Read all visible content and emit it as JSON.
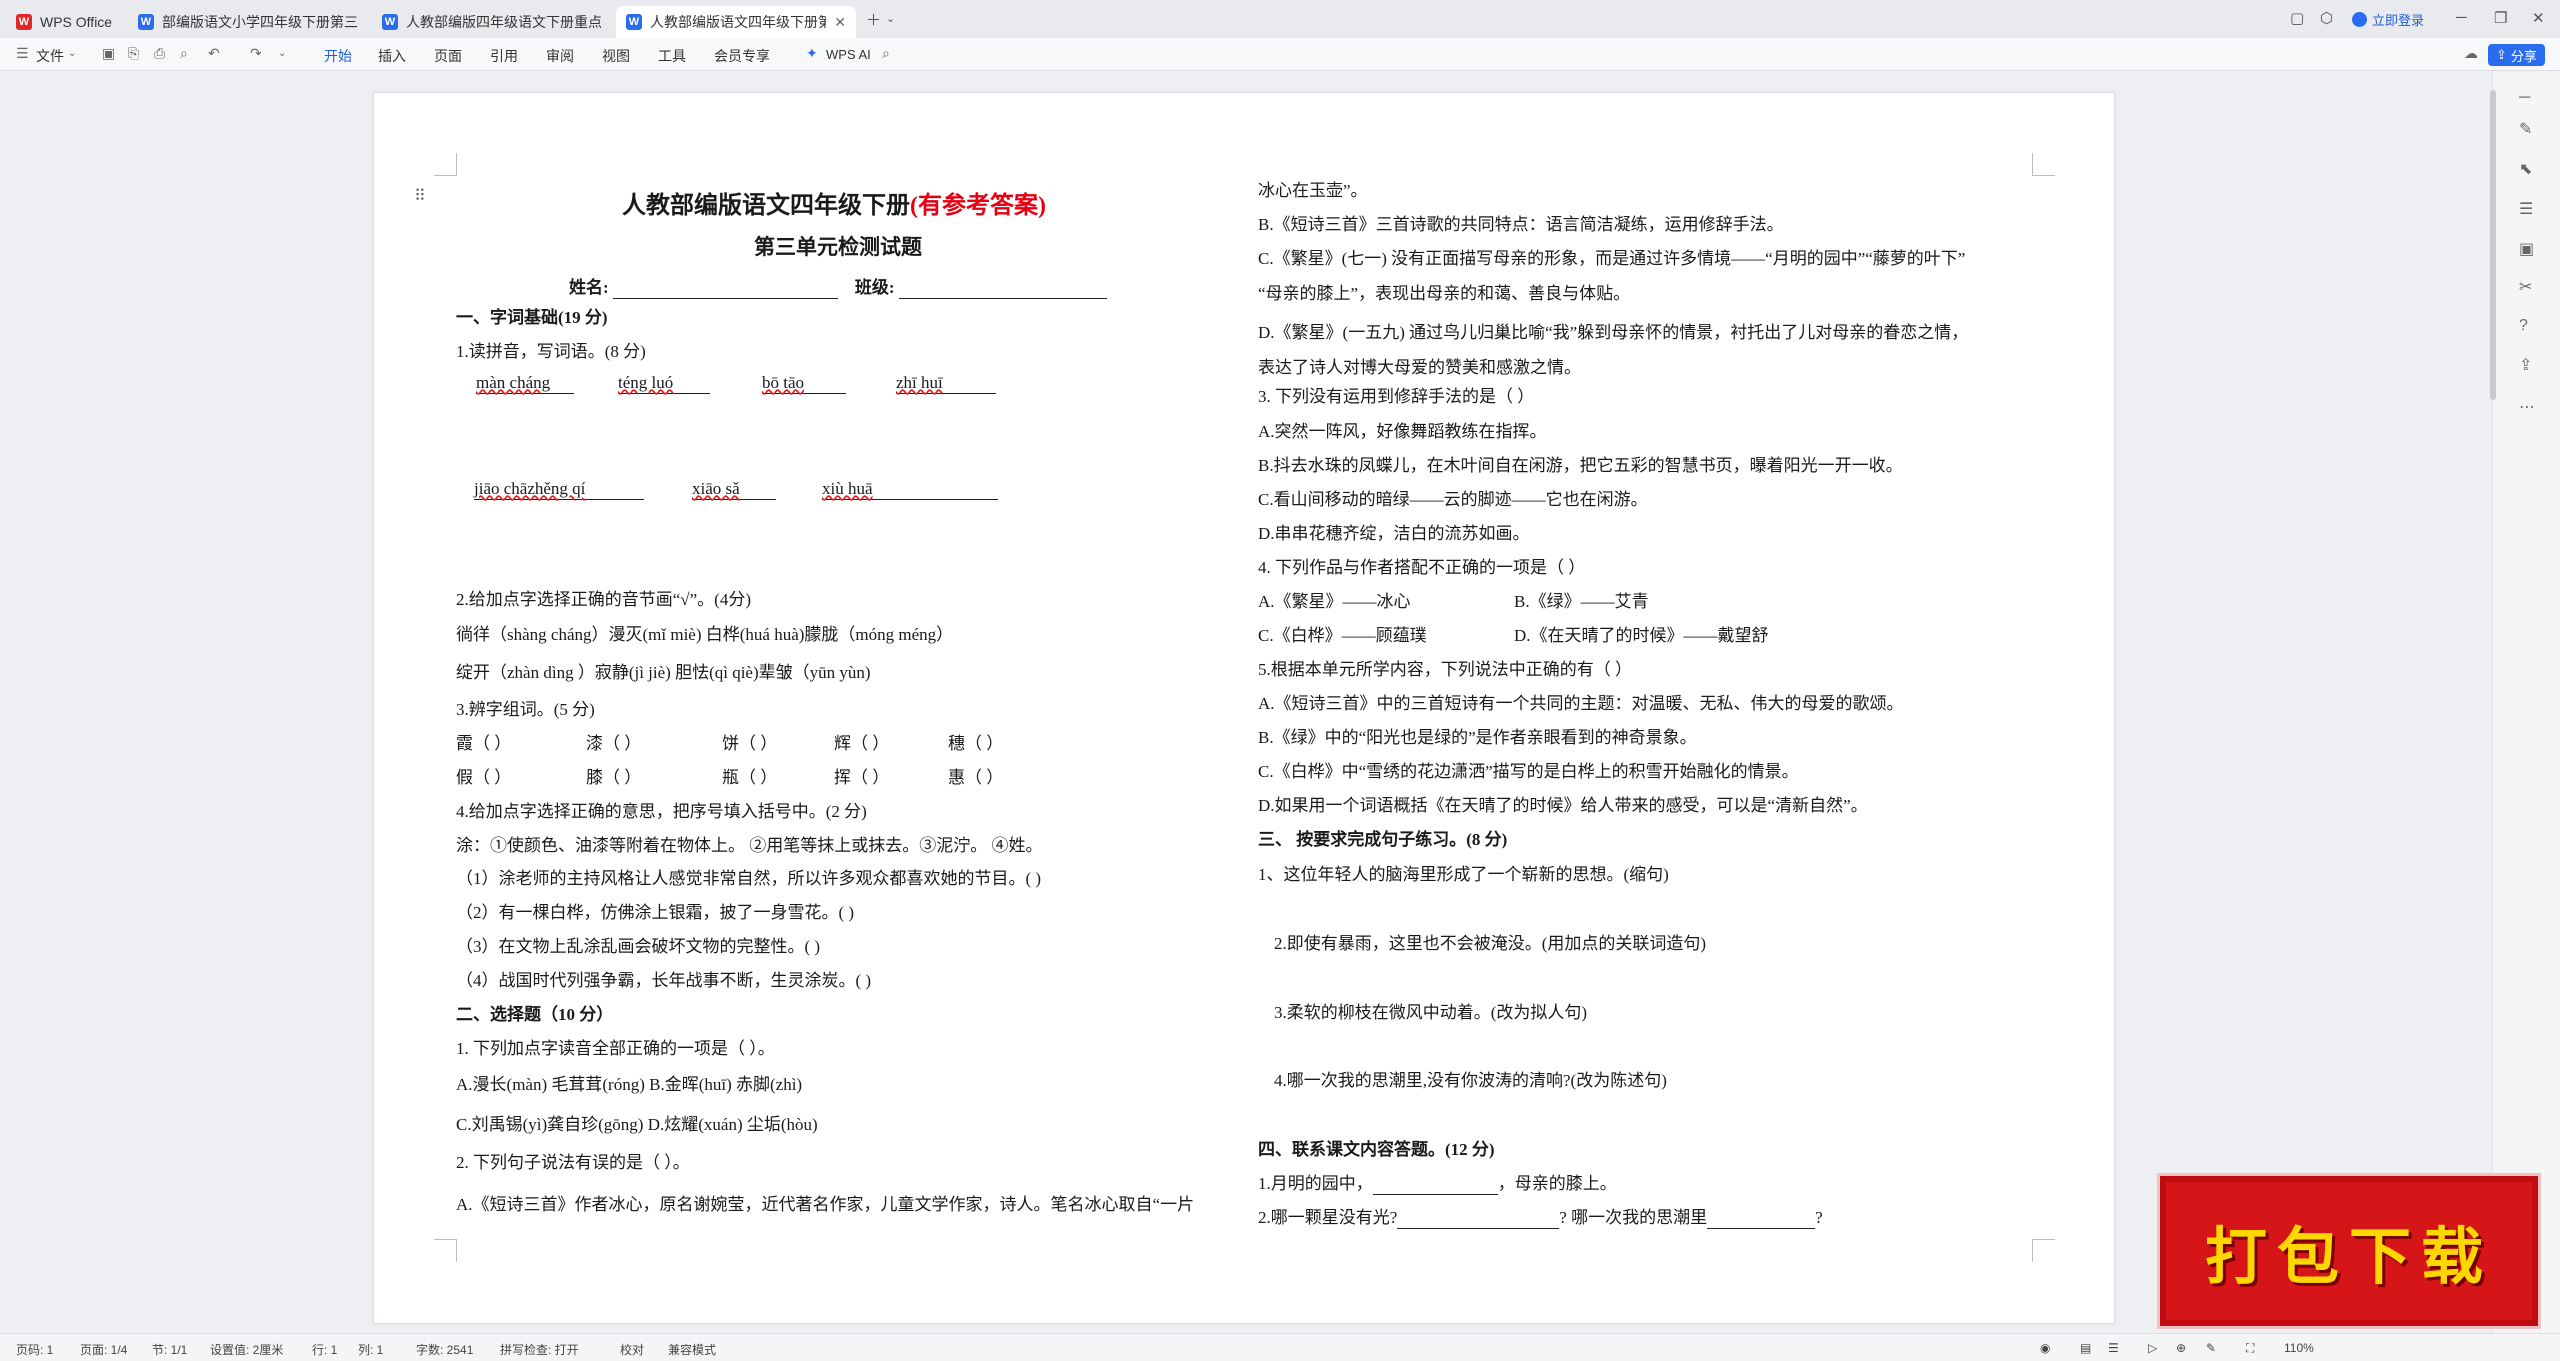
{
  "tabs": [
    {
      "label": "WPS Office",
      "icon": "wps-icon"
    },
    {
      "label": "部编版语文小学四年级下册第三单元",
      "icon": "word-doc-icon"
    },
    {
      "label": "人教部编版四年级语文下册重点学校",
      "icon": "word-doc-icon"
    },
    {
      "label": "人教部编版语文四年级下册第",
      "icon": "word-doc-icon"
    }
  ],
  "titlebar": {
    "login": "立即登录"
  },
  "ribbon": {
    "file": "文件",
    "menus": [
      "开始",
      "插入",
      "页面",
      "引用",
      "审阅",
      "视图",
      "工具",
      "会员专享"
    ],
    "active_menu": "开始",
    "ai": "WPS AI",
    "share": "分享"
  },
  "doc": {
    "title_main": "人教部编版语文四年级下册",
    "title_tag": "(有参考答案)",
    "subtitle": "第三单元检测试题",
    "name_label": "姓名:",
    "class_label": "班级:",
    "left": [
      "一、字词基础(19 分)",
      "1.读拼音，写词语。(8 分)",
      "2.给加点字选择正确的音节画“√”。(4分)",
      "徜徉（shàng cháng）漫灭(mǐ  miè)     白桦(huá  huà)朦胧（móng  méng）",
      "绽开（zhàn dìng ）寂静(jì  jiè)     胆怯(qì  qiè)辈皱（yūn  yùn)",
      "3.辨字组词。(5 分)",
      "4.给加点字选择正确的意思，把序号填入括号中。(2 分)",
      "涂：①使颜色、油漆等附着在物体上。 ②用笔等抹上或抹去。③泥泞。 ④姓。",
      "（1）涂老师的主持风格让人感觉非常自然，所以许多观众都喜欢她的节目。(    )",
      "（2）有一棵白桦，仿佛涂上银霜，披了一身雪花。(    )",
      "（3）在文物上乱涂乱画会破坏文物的完整性。(    )",
      "（4）战国时代列强争霸，长年战事不断，生灵涂炭。(     )",
      "二、选择题（10 分）",
      "1. 下列加点字读音全部正确的一项是（    ）。",
      "A.漫长(màn)  毛茸茸(róng) B.金晖(huī) 赤脚(zhì)",
      "C.刘禹锡(yì)龚自珍(gōng)  D.炫耀(xuán) 尘垢(hòu)",
      "2. 下列句子说法有误的是（    ）。",
      "A.《短诗三首》作者冰心，原名谢婉莹，近代著名作家，儿童文学作家，诗人。笔名冰心取自“一片"
    ],
    "pinyin_row1": [
      "màn cháng",
      "téng luó",
      "bō tāo",
      "zhī huī"
    ],
    "pinyin_row2": [
      "jiāo chāzhěng qí",
      "xiāo sǎ",
      "xiù huā"
    ],
    "bianzi_row1": [
      "霞（     ）",
      "漆（     ）",
      "饼（     ）",
      "辉（     ）",
      "穗（     ）"
    ],
    "bianzi_row2": [
      "假（     ）",
      "膝（     ）",
      "瓶（     ）",
      "挥（     ）",
      "惠（     ）"
    ],
    "right": [
      "冰心在玉壶”。",
      "B.《短诗三首》三首诗歌的共同特点：语言简洁凝练，运用修辞手法。",
      "C.《繁星》(七一) 没有正面描写母亲的形象，而是通过许多情境——“月明的园中”“藤萝的叶下”",
      "“母亲的膝上”，表现出母亲的和蔼、善良与体贴。",
      "D.《繁星》(一五九) 通过鸟儿归巢比喻“我”躲到母亲怀的情景，衬托出了儿对母亲的眷恋之情，",
      "表达了诗人对博大母爱的赞美和感激之情。",
      "3. 下列没有运用到修辞手法的是（    ）",
      "A.突然一阵风，好像舞蹈教练在指挥。",
      "B.抖去水珠的凤蝶儿，在木叶间自在闲游，把它五彩的智慧书页，曝着阳光一开一收。",
      "C.看山间移动的暗绿——云的脚迹——它也在闲游。",
      "D.串串花穗齐绽，洁白的流苏如画。",
      "4. 下列作品与作者搭配不正确的一项是（    ）",
      "5.根据本单元所学内容，下列说法中正确的有（    ）",
      "A.《短诗三首》中的三首短诗有一个共同的主题：对温暖、无私、伟大的母爱的歌颂。",
      "B.《绿》中的“阳光也是绿的”是作者亲眼看到的神奇景象。",
      "C.《白桦》中“雪绣的花边潇洒”描写的是白桦上的积雪开始融化的情景。",
      "D.如果用一个词语概括《在天晴了的时候》给人带来的感受，可以是“清新自然”。",
      "三、  按要求完成句子练习。(8 分)",
      "1、这位年轻人的脑海里形成了一个崭新的思想。(缩句)",
      "2.即使有暴雨，这里也不会被淹没。(用加点的关联词造句)",
      "3.柔软的柳枝在微风中动着。(改为拟人句)",
      "4.哪一次我的思潮里,没有你波涛的清响?(改为陈述句)",
      "四、联系课文内容答题。(12 分)",
      "1.月明的园中，",
      "，母亲的膝上。",
      "2.哪一颗星没有光?",
      "? 哪一次我的思潮里",
      "?"
    ],
    "authors": [
      "A.《繁星》——冰心",
      "B.《绿》——艾青",
      "C.《白桦》——顾蕴璞",
      "D.《在天晴了的时候》——戴望舒"
    ]
  },
  "statusbar": {
    "page": "页码: 1",
    "pages": "页面: 1/4",
    "section": "节: 1/1",
    "setting": "设置值: 2厘米",
    "row": "行: 1",
    "col": "列: 1",
    "words": "字数: 2541",
    "spell": "拼写检查: 打开",
    "proof": "校对",
    "compat": "兼容模式",
    "zoom": "110%"
  },
  "banner": "打包下载"
}
